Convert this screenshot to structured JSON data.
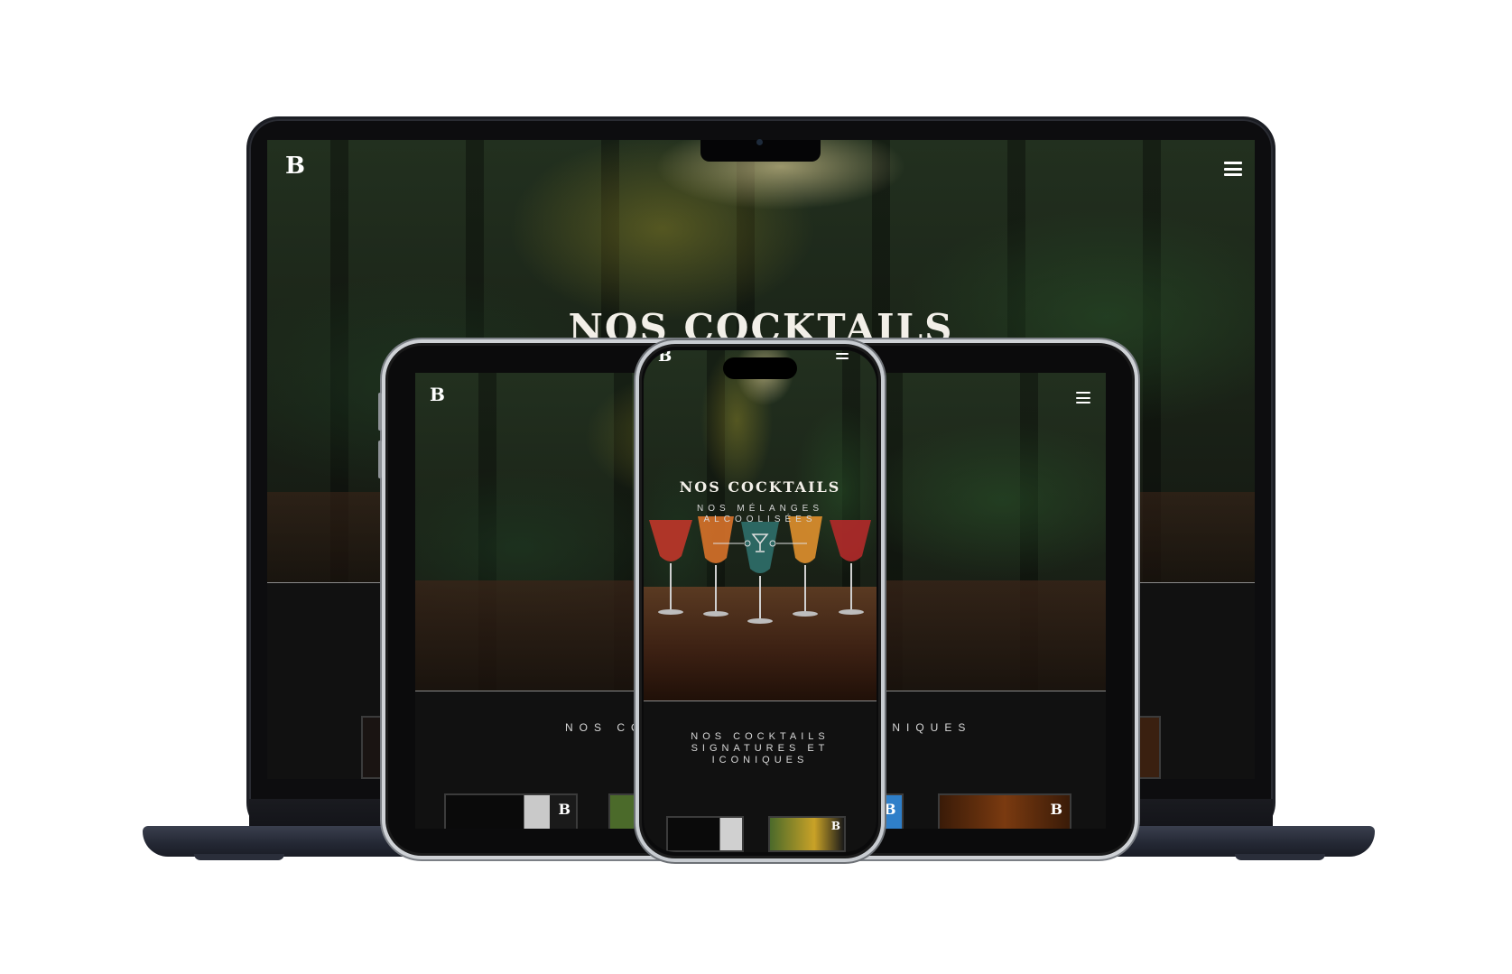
{
  "site": {
    "logo_text": "B",
    "menu_icon": "hamburger-menu-icon",
    "hero_title": "NOS COCKTAILS",
    "hero_subtitle_line1": "NOS MÉLANGES",
    "hero_subtitle_line2": "ALCOOLISÉES",
    "section_heading_tablet_left": "NOS COC",
    "section_heading_tablet_right": "ONIQUES",
    "section_heading_phone_line1": "NOS COCKTAILS",
    "section_heading_phone_line2": "SIGNATURES ET",
    "section_heading_phone_line3": "ICONIQUES",
    "thumb_logo": "B"
  },
  "colors": {
    "page_background": "#ffffff",
    "site_background": "#111111",
    "text_primary": "#f2efe8",
    "text_secondary": "#d8d8d8"
  }
}
